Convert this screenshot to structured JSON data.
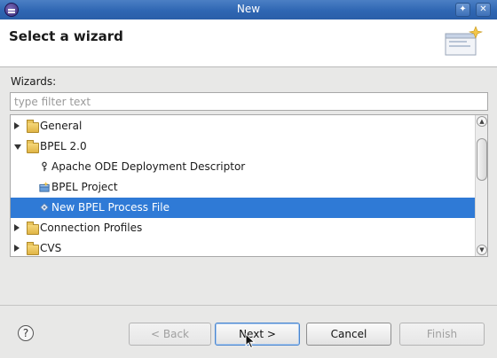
{
  "window": {
    "title": "New"
  },
  "header": {
    "heading": "Select a wizard"
  },
  "filter": {
    "label": "Wizards:",
    "placeholder": "type filter text",
    "value": ""
  },
  "tree": {
    "items": [
      {
        "label": "General",
        "level": 0,
        "state": "collapsed",
        "icon": "folder-icon",
        "selected": false
      },
      {
        "label": "BPEL 2.0",
        "level": 0,
        "state": "expanded",
        "icon": "folder-icon",
        "selected": false
      },
      {
        "label": "Apache ODE Deployment Descriptor",
        "level": 1,
        "state": "leaf",
        "icon": "deployment-descriptor-icon",
        "selected": false
      },
      {
        "label": "BPEL Project",
        "level": 1,
        "state": "leaf",
        "icon": "project-icon",
        "selected": false
      },
      {
        "label": "New BPEL Process File",
        "level": 1,
        "state": "leaf",
        "icon": "bpel-file-icon",
        "selected": true
      },
      {
        "label": "Connection Profiles",
        "level": 0,
        "state": "collapsed",
        "icon": "folder-icon",
        "selected": false
      },
      {
        "label": "CVS",
        "level": 0,
        "state": "collapsed",
        "icon": "folder-icon",
        "selected": false
      }
    ]
  },
  "footer": {
    "help_label": "?",
    "back_label": "< Back",
    "next_label": "Next >",
    "cancel_label": "Cancel",
    "finish_label": "Finish"
  },
  "colors": {
    "selection": "#2f7ad6",
    "titlebar": "#2f66b3"
  }
}
